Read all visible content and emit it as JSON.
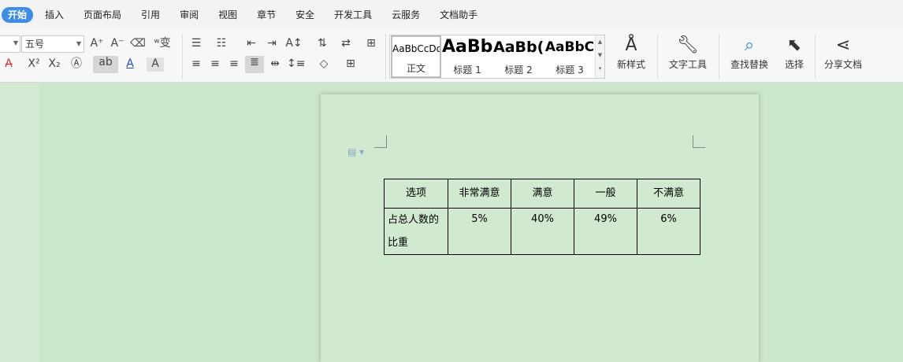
{
  "menu": {
    "tabs": [
      "开始",
      "插入",
      "页面布局",
      "引用",
      "审阅",
      "视图",
      "章节",
      "安全",
      "开发工具",
      "云服务",
      "文档助手"
    ],
    "active": "开始"
  },
  "ribbon": {
    "font_size": "五号",
    "styles": [
      {
        "preview": "AaBbCcDd",
        "name": "正文"
      },
      {
        "preview": "AaBb",
        "name": "标题 1"
      },
      {
        "preview": "AaBb(",
        "name": "标题 2"
      },
      {
        "preview": "AaBbC",
        "name": "标题 3"
      }
    ],
    "buttons": {
      "new_style": "新样式",
      "text_tools": "文字工具",
      "find_replace": "查找替换",
      "select": "选择",
      "share_doc": "分享文档"
    },
    "icons": [
      "increase-font",
      "decrease-font",
      "clear-format",
      "phonetic",
      "bullets",
      "numbering",
      "indent-decrease",
      "indent-increase",
      "text-direction",
      "sort",
      "line-spacing-adjust",
      "table-grid",
      "strikethrough",
      "superscript",
      "subscript",
      "text-effect",
      "highlight",
      "font-color",
      "char-shading",
      "align-left",
      "align-center",
      "align-right",
      "justify",
      "distributed",
      "line-spacing",
      "shading",
      "borders"
    ]
  },
  "table": {
    "headers": [
      "选项",
      "非常满意",
      "满意",
      "一般",
      "不满意"
    ],
    "row": [
      "占总人数的比重",
      "5%",
      "40%",
      "49%",
      "6%"
    ]
  }
}
